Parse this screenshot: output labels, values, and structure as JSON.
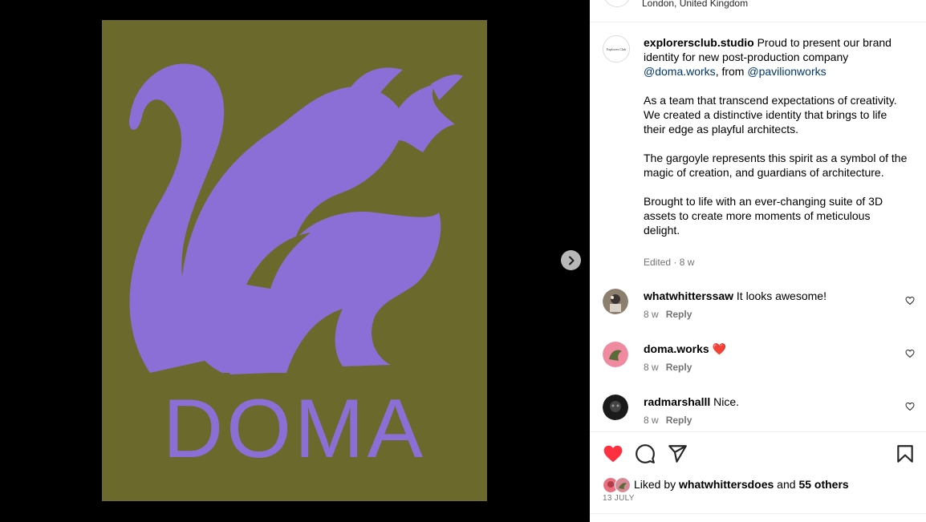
{
  "location": "London, United Kingdom",
  "poster": {
    "wordmark": "DOMA",
    "background_color": "#6b6a2c",
    "figure_color": "#8b6fd6"
  },
  "caption": {
    "username": "explorersclub.studio",
    "avatar_text": "Explorers Club",
    "text_1": " Proud to present our brand identity for new post-production company ",
    "mention_1": "@doma.works",
    "text_2": ", from ",
    "mention_2": "@pavilionworks",
    "paragraph_2": "As a team that transcend expectations of creativity. We created a distinctive identity that brings to life their edge as playful architects.",
    "paragraph_3": "The gargoyle represents this spirit as a symbol of the magic of creation, and guardians of architecture.",
    "paragraph_4": "Brought to life with an ever-changing suite of 3D assets to create more moments of meticulous delight.",
    "edited": "Edited · 8 w"
  },
  "comments": [
    {
      "username": "whatwhitterssaw",
      "text": " It looks awesome!",
      "time": "8 w",
      "reply": "Reply"
    },
    {
      "username": "doma.works",
      "text": " ❤️",
      "time": "8 w",
      "reply": "Reply"
    },
    {
      "username": "radmarshalll",
      "text": " Nice.",
      "time": "8 w",
      "reply": "Reply"
    }
  ],
  "likes": {
    "prefix": "Liked by ",
    "user": "whatwhittersdoes",
    "middle": " and ",
    "others": "55 others",
    "date": "13 JULY"
  },
  "colors": {
    "like_red": "#ff3040",
    "mention_blue": "#00376b",
    "muted": "#737373"
  }
}
